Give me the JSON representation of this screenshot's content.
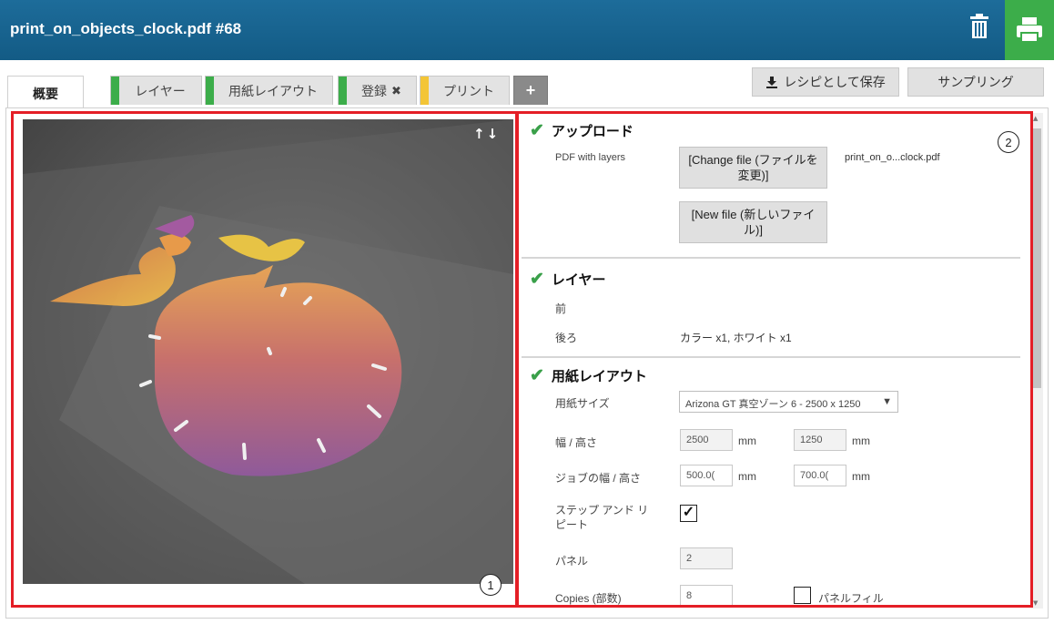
{
  "window": {
    "title": "print_on_objects_clock.pdf #68"
  },
  "icons": {
    "trash": "trash-icon",
    "print": "printer-icon",
    "download": "download-icon",
    "plus": "plus-icon",
    "check": "check-icon",
    "close": "close-icon"
  },
  "colors": {
    "titlebar": "#176494",
    "print_button": "#3cad4a",
    "stripe_green": "#3cad4a",
    "stripe_yellow": "#f3c536",
    "highlight_box": "#e41e26",
    "check": "#3aa04a"
  },
  "tabs": [
    {
      "label": "概要",
      "active": true,
      "stripe": ""
    },
    {
      "label": "レイヤー",
      "active": false,
      "stripe": "green"
    },
    {
      "label": "用紙レイアウト",
      "active": false,
      "stripe": "green"
    },
    {
      "label": "登録",
      "active": false,
      "stripe": "green",
      "suffix": "✖"
    },
    {
      "label": "プリント",
      "active": false,
      "stripe": "yellow"
    },
    {
      "label": "+",
      "active": false,
      "stripe": ""
    }
  ],
  "toolbar": {
    "save_recipe": "レシピとして保存",
    "sampling": "サンプリング"
  },
  "preview": {
    "arrows": "↑↓",
    "callout": "1"
  },
  "settings": {
    "callout": "2",
    "upload": {
      "heading": "アップロード",
      "pdf_label": "PDF with layers",
      "change_file": "[Change file (ファイルを変更)]",
      "filename": "print_on_o...clock.pdf",
      "new_file": "[New file (新しいファイル)]"
    },
    "layers": {
      "heading": "レイヤー",
      "front_label": "前",
      "back_label": "後ろ",
      "back_value": "カラー x1, ホワイト x1"
    },
    "layout": {
      "heading": "用紙レイアウト",
      "media_size_label": "用紙サイズ",
      "media_size_value": "Arizona GT 真空ゾーン 6 - 2500 x 1250",
      "width_height_label": "幅 / 高さ",
      "width": "2500",
      "height": "1250",
      "unit": "mm",
      "job_wh_label": "ジョブの幅 / 高さ",
      "job_width": "500.0(",
      "job_height": "700.0(",
      "step_repeat_label": "ステップ アンド リピート",
      "step_repeat_checked": true,
      "panels_label": "パネル",
      "panels_value": "2",
      "copies_label": "Copies (部数)",
      "copies_value": "8",
      "panel_fill_label": "パネルフィル",
      "panel_fill_checked": false
    }
  }
}
